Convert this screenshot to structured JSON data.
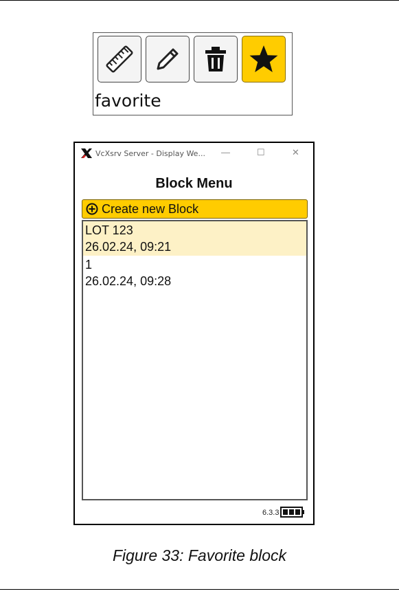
{
  "toolbar": {
    "buttons": [
      {
        "name": "measure",
        "icon": "ruler-icon",
        "active": false
      },
      {
        "name": "edit",
        "icon": "pencil-icon",
        "active": false
      },
      {
        "name": "delete",
        "icon": "trash-icon",
        "active": false
      },
      {
        "name": "favorite",
        "icon": "star-icon",
        "active": true
      }
    ],
    "caption": "favorite"
  },
  "window": {
    "title": "VcXsrv Server - Display We...",
    "controls": {
      "minimize": "—",
      "maximize": "☐",
      "close": "✕"
    }
  },
  "app": {
    "heading": "Block Menu",
    "create_button": "Create new Block",
    "blocks": [
      {
        "name": "LOT 123",
        "date": "26.02.24, 09:21",
        "favorite": true
      },
      {
        "name": "1",
        "date": "26.02.24, 09:28",
        "favorite": false
      }
    ],
    "version": "6.3.3"
  },
  "figure_caption": "Figure 33: Favorite block",
  "colors": {
    "accent": "#ffcc00",
    "favorite_highlight": "#fdf1c6"
  }
}
